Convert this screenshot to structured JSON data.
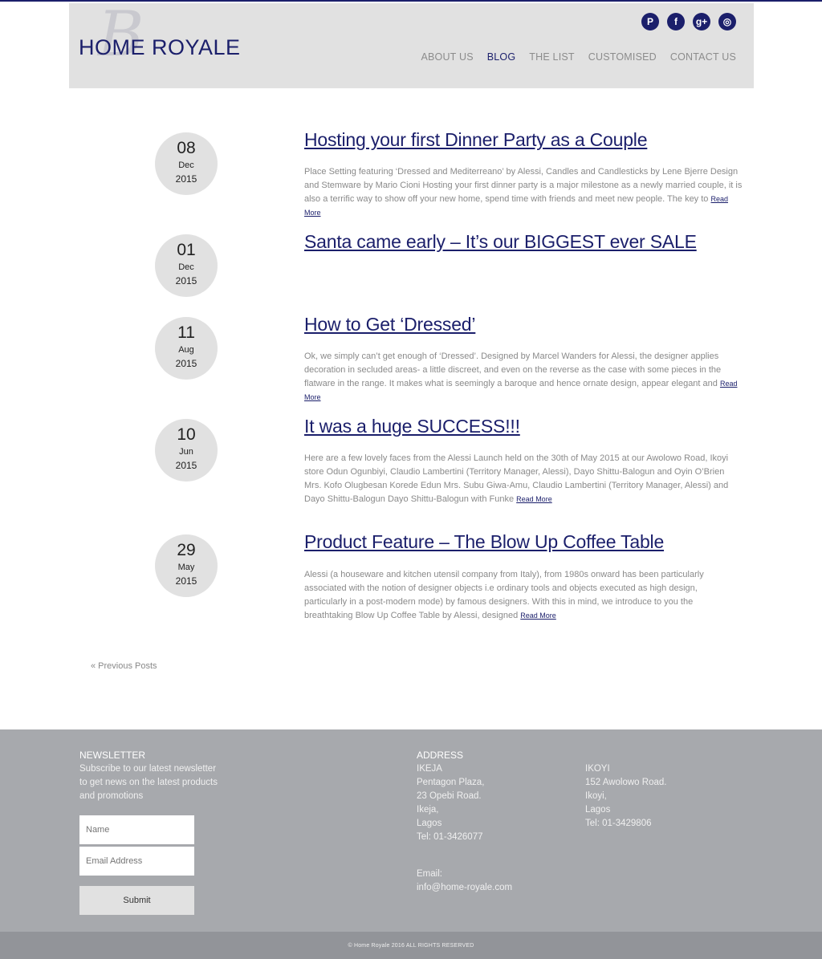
{
  "header": {
    "logo_mark": "B",
    "logo_text": "HOME ROYALE",
    "social": [
      {
        "icon": "pinterest-icon",
        "glyph": "P"
      },
      {
        "icon": "facebook-icon",
        "glyph": "f"
      },
      {
        "icon": "google-plus-icon",
        "glyph": "g+"
      },
      {
        "icon": "instagram-icon",
        "glyph": "◎"
      }
    ],
    "nav": [
      {
        "label": "ABOUT US",
        "active": false
      },
      {
        "label": "BLOG",
        "active": true
      },
      {
        "label": "THE LIST",
        "active": false
      },
      {
        "label": "CUSTOMISED",
        "active": false
      },
      {
        "label": "CONTACT US",
        "active": false
      }
    ]
  },
  "posts": [
    {
      "day": "08",
      "month": "Dec",
      "year": "2015",
      "title": "Hosting your first Dinner Party as a Couple",
      "excerpt": "Place Setting featuring ‘Dressed and Mediterreano’ by Alessi, Candles and Candlesticks by Lene Bjerre Design and Stemware by Mario Cioni Hosting your first dinner party is a major milestone as a newly married couple, it is also a terrific way to show off your new home, spend time with friends and meet new people. The key to",
      "read_more": "Read More"
    },
    {
      "day": "01",
      "month": "Dec",
      "year": "2015",
      "title": "Santa came early – It’s our BIGGEST ever SALE",
      "excerpt": "",
      "read_more": ""
    },
    {
      "day": "11",
      "month": "Aug",
      "year": "2015",
      "title": "How to Get ‘Dressed’",
      "excerpt": "Ok, we simply can’t get enough of ‘Dressed’.  Designed by Marcel Wanders for Alessi, the designer applies decoration in secluded areas- a little discreet, and even on the reverse as the case with some pieces in the flatware in the range. It makes what is seemingly a baroque and hence ornate design, appear elegant and",
      "read_more": "Read More"
    },
    {
      "day": "10",
      "month": "Jun",
      "year": "2015",
      "title": "It was a huge SUCCESS!!!",
      "excerpt": "Here are a few lovely faces from the Alessi Launch held on the 30th of May 2015 at our Awolowo Road, Ikoyi store Odun Ogunbiyi,  Claudio Lambertini (Territory Manager, Alessi), Dayo Shittu-Balogun and Oyin O’Brien Mrs. Kofo Olugbesan Korede Edun Mrs. Subu Giwa-Amu, Claudio Lambertini (Territory Manager, Alessi) and Dayo Shittu-Balogun Dayo Shittu-Balogun with Funke",
      "read_more": "Read More"
    },
    {
      "day": "29",
      "month": "May",
      "year": "2015",
      "title": "Product Feature – The Blow Up Coffee Table",
      "excerpt": "Alessi (a houseware and kitchen utensil company from Italy), from 1980s onward has been particularly associated with the notion of designer objects i.e ordinary tools and objects executed as high design, particularly in a post-modern mode) by famous designers. With this in mind, we introduce to you the breathtaking Blow Up Coffee Table by Alessi, designed",
      "read_more": "Read More"
    }
  ],
  "pagination": {
    "previous": "« Previous Posts"
  },
  "footer": {
    "newsletter": {
      "heading": "NEWSLETTER",
      "text": "Subscribe to our latest newsletter to get news on the latest products and promotions",
      "name_placeholder": "Name",
      "email_placeholder": "Email Address",
      "submit_label": "Submit"
    },
    "address": {
      "heading": "ADDRESS",
      "ikeja": [
        "IKEJA",
        "Pentagon Plaza,",
        "23 Opebi Road.",
        "Ikeja,",
        "Lagos",
        "Tel: 01-3426077"
      ],
      "email_label": "Email:",
      "email": "info@home-royale.com",
      "ikoyi": [
        "IKOYI",
        "152 Awolowo Road.",
        "Ikoyi,",
        "Lagos",
        "Tel: 01-3429806"
      ]
    },
    "copyright": "© Home Royale 2016 ALL RIGHTS RESERVED"
  }
}
